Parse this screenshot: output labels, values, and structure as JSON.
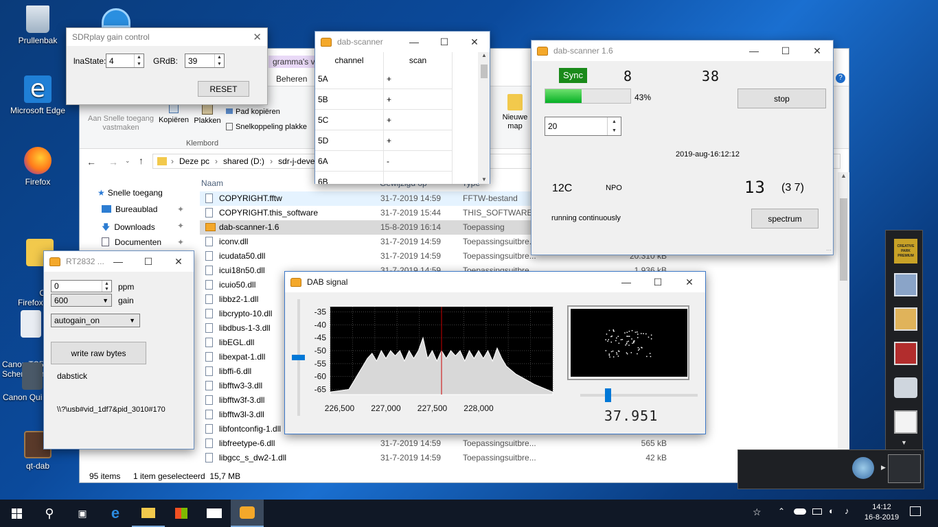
{
  "desktop": {
    "icons": [
      {
        "label": "Prullenbak",
        "icon": "recycle-bin-icon"
      },
      {
        "label": "Microsoft Edge",
        "icon": "edge-icon"
      },
      {
        "label": "Firefox",
        "icon": "firefox-icon"
      },
      {
        "label": "Oud\nFirefox-ge",
        "icon": "folder-icon"
      },
      {
        "label": "Canon TS50\nSchermhan",
        "icon": "canon-icon"
      },
      {
        "label": "Canon Qui",
        "icon": "canon-quick-icon"
      },
      {
        "label": "qt-dab",
        "icon": "qt-dab-icon"
      }
    ]
  },
  "explorer": {
    "ribbon": {
      "tab_partial": "gramma's vo",
      "tab_beheren": "Beheren",
      "pin_label": "Aan Snelle toegang vastmaken",
      "copy": "Kopiëren",
      "paste": "Plakken",
      "copy_path": "Pad kopiëren",
      "paste_shortcut": "Snelkoppeling plakke",
      "group": "Klembord",
      "new_folder": "Nieuwe map"
    },
    "path": {
      "this_pc": "Deze pc",
      "drive": "shared (D:)",
      "folder": "sdr-j-deve"
    },
    "nav": [
      "Snelle toegang",
      "Bureaublad",
      "Downloads",
      "Documenten"
    ],
    "columns": {
      "name": "Naam",
      "date": "Gewijzigd op",
      "type": "Type"
    },
    "files": [
      {
        "name": "COPYRIGHT.fftw",
        "date": "31-7-2019 14:59",
        "type": "FFTW-bestand",
        "size": ""
      },
      {
        "name": "COPYRIGHT.this_software",
        "date": "31-7-2019 15:44",
        "type": "THIS_SOFTWARE-...",
        "size": ""
      },
      {
        "name": "dab-scanner-1.6",
        "date": "15-8-2019 16:14",
        "type": "Toepassing",
        "size": ""
      },
      {
        "name": "iconv.dll",
        "date": "31-7-2019 14:59",
        "type": "Toepassingsuitbre...",
        "size": ""
      },
      {
        "name": "icudata50.dll",
        "date": "31-7-2019 14:59",
        "type": "Toepassingsuitbre...",
        "size": "20.310 kB"
      },
      {
        "name": "icui18n50.dll",
        "date": "31-7-2019 14:59",
        "type": "Toepassingsuitbre...",
        "size": "1.936 kB"
      },
      {
        "name": "icuio50.dll",
        "date": "",
        "type": "",
        "size": ""
      },
      {
        "name": "libbz2-1.dll",
        "date": "",
        "type": "",
        "size": ""
      },
      {
        "name": "libcrypto-10.dll",
        "date": "",
        "type": "",
        "size": ""
      },
      {
        "name": "libdbus-1-3.dll",
        "date": "",
        "type": "",
        "size": ""
      },
      {
        "name": "libEGL.dll",
        "date": "",
        "type": "",
        "size": ""
      },
      {
        "name": "libexpat-1.dll",
        "date": "",
        "type": "",
        "size": ""
      },
      {
        "name": "libffi-6.dll",
        "date": "",
        "type": "",
        "size": ""
      },
      {
        "name": "libfftw3-3.dll",
        "date": "",
        "type": "",
        "size": ""
      },
      {
        "name": "libfftw3f-3.dll",
        "date": "",
        "type": "",
        "size": ""
      },
      {
        "name": "libfftw3l-3.dll",
        "date": "",
        "type": "",
        "size": ""
      },
      {
        "name": "libfontconfig-1.dll",
        "date": "",
        "type": "",
        "size": ""
      },
      {
        "name": "libfreetype-6.dll",
        "date": "31-7-2019 14:59",
        "type": "Toepassingsuitbre...",
        "size": "565 kB"
      },
      {
        "name": "libgcc_s_dw2-1.dll",
        "date": "31-7-2019 14:59",
        "type": "Toepassingsuitbre...",
        "size": "42 kB"
      }
    ],
    "status_count": "95 items",
    "status_selected": "1 item geselecteerd  15,7 MB"
  },
  "sdrplay": {
    "title": "SDRplay gain control",
    "lna_label": "lnaState:",
    "lna_value": "4",
    "grdb_label": "GRdB:",
    "grdb_value": "39",
    "reset": "RESET"
  },
  "scanner_small": {
    "title": "dab-scanner",
    "col_channel": "channel",
    "col_scan": "scan",
    "rows": [
      {
        "channel": "5A",
        "scan": "+"
      },
      {
        "channel": "5B",
        "scan": "+"
      },
      {
        "channel": "5C",
        "scan": "+"
      },
      {
        "channel": "5D",
        "scan": "+"
      },
      {
        "channel": "6A",
        "scan": "-"
      },
      {
        "channel": "6B",
        "scan": ""
      }
    ]
  },
  "scanner_main": {
    "title": "dab-scanner 1.6",
    "sync": "Sync",
    "lcd1": "8",
    "lcd2": "38",
    "progress": 0.43,
    "progress_label": "43%",
    "stop": "stop",
    "spin_value": "20",
    "datetime": "2019-aug-16:12:12",
    "channel": "12C",
    "country": "NPO",
    "lcd3": "13",
    "count": "(3 7)",
    "status": "running continuously",
    "spectrum": "spectrum",
    "sync_color": "#1a8a1a"
  },
  "rt2832": {
    "title": "RT2832 ...",
    "ppm_value": "0",
    "ppm_label": "ppm",
    "gain_value": "600",
    "gain_label": "gain",
    "agc": "autogain_on",
    "write_raw": "write raw bytes",
    "device": "dabstick",
    "usb": "\\\\?\\usb#vid_1df7&pid_3010#170"
  },
  "dab_signal": {
    "title": "DAB signal",
    "freq_readout": "37.951",
    "slider_left_fraction": 0.5,
    "slider_right_fraction": 0.21
  },
  "chart_data": {
    "type": "area",
    "title": "",
    "xlabel": "",
    "ylabel": "",
    "x_ticks": [
      "226,500",
      "227,000",
      "227,500",
      "228,000"
    ],
    "y_ticks": [
      "-35",
      "-40",
      "-45",
      "-50",
      "-55",
      "-60",
      "-65"
    ],
    "ylim": [
      -67,
      -33
    ],
    "xlim": [
      226400,
      228800
    ],
    "x": [
      226400,
      226600,
      226650,
      226700,
      226750,
      226800,
      226850,
      226900,
      226950,
      227000,
      227050,
      227100,
      227150,
      227200,
      227250,
      227300,
      227350,
      227400,
      227450,
      227500,
      227550,
      227600,
      227650,
      227700,
      227750,
      227800,
      227850,
      227900,
      227950,
      228000,
      228050,
      228100,
      228150,
      228200,
      228250,
      228300,
      228400,
      228600,
      228800
    ],
    "y": [
      -66,
      -65,
      -62,
      -59,
      -56,
      -53,
      -51,
      -54,
      -50,
      -53,
      -50,
      -52,
      -50,
      -54,
      -50,
      -53,
      -50,
      -45,
      -53,
      -50,
      -54,
      -50,
      -53,
      -50,
      -52,
      -50,
      -54,
      -50,
      -53,
      -50,
      -53,
      -50,
      -54,
      -49,
      -53,
      -56,
      -59,
      -63,
      -66
    ]
  },
  "taskbar": {
    "time": "14:12",
    "date": "16-8-2019"
  },
  "tray_panel": {
    "label": "CREATIVE PARK PREMIUM"
  }
}
